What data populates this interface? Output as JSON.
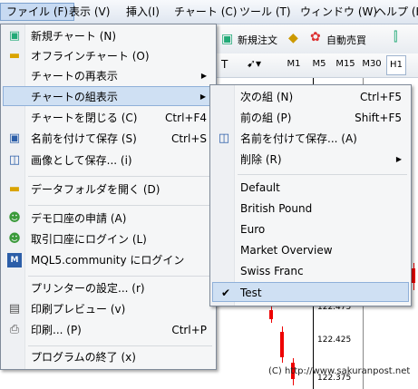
{
  "menubar": {
    "items": [
      "ファイル (F)",
      "表示 (V)",
      "挿入(I)",
      "チャート (C)",
      "ツール (T)",
      "ウィンドウ (W)",
      "ヘルプ (H)"
    ]
  },
  "toolbar": {
    "new_order": "新規注文",
    "auto_trade": "自動売買",
    "timeframes": [
      "M1",
      "M5",
      "M15",
      "M30",
      "H1"
    ],
    "selected_timeframe": "H1"
  },
  "chart": {
    "prices": [
      "122.475",
      "122.425",
      "122.375"
    ]
  },
  "copyright": "(C) http://www.sakuranpost.net",
  "file_menu": {
    "items": [
      {
        "label": "新規チャート (N)",
        "shortcut": "",
        "icon": "new-chart-icon"
      },
      {
        "label": "オフラインチャート (O)",
        "shortcut": "",
        "icon": "folder-icon"
      },
      {
        "label": "チャートの再表示",
        "shortcut": "",
        "arrow": true
      },
      {
        "label": "チャートの組表示",
        "shortcut": "",
        "arrow": true,
        "highlighted": true
      },
      {
        "label": "チャートを閉じる (C)",
        "shortcut": "Ctrl+F4"
      },
      {
        "label": "名前を付けて保存 (S)",
        "shortcut": "Ctrl+S",
        "icon": "save-icon"
      },
      {
        "label": "画像として保存... (i)",
        "shortcut": "",
        "icon": "image-save-icon"
      },
      {
        "label": "データフォルダを開く (D)",
        "shortcut": "",
        "icon": "folder-icon"
      },
      {
        "label": "デモ口座の申請 (A)",
        "shortcut": "",
        "icon": "user-add-icon"
      },
      {
        "label": "取引口座にログイン (L)",
        "shortcut": "",
        "icon": "user-login-icon"
      },
      {
        "label": "MQL5.community にログイン",
        "shortcut": "",
        "icon": "mql5-icon"
      },
      {
        "label": "プリンターの設定... (r)",
        "shortcut": ""
      },
      {
        "label": "印刷プレビュー (v)",
        "shortcut": "",
        "icon": "print-preview-icon"
      },
      {
        "label": "印刷... (P)",
        "shortcut": "Ctrl+P",
        "icon": "printer-icon"
      },
      {
        "label": "プログラムの終了 (x)",
        "shortcut": ""
      }
    ]
  },
  "profiles_menu": {
    "items": [
      {
        "label": "次の組 (N)",
        "shortcut": "Ctrl+F5"
      },
      {
        "label": "前の組 (P)",
        "shortcut": "Shift+F5"
      },
      {
        "label": "名前を付けて保存... (A)",
        "shortcut": "",
        "icon": "save-profile-icon"
      },
      {
        "label": "削除 (R)",
        "shortcut": "",
        "arrow": true
      },
      {
        "label": "Default",
        "shortcut": ""
      },
      {
        "label": "British Pound",
        "shortcut": ""
      },
      {
        "label": "Euro",
        "shortcut": ""
      },
      {
        "label": "Market Overview",
        "shortcut": ""
      },
      {
        "label": "Swiss Franc",
        "shortcut": ""
      },
      {
        "label": "Test",
        "shortcut": "",
        "checked": true,
        "highlighted": true
      }
    ]
  }
}
